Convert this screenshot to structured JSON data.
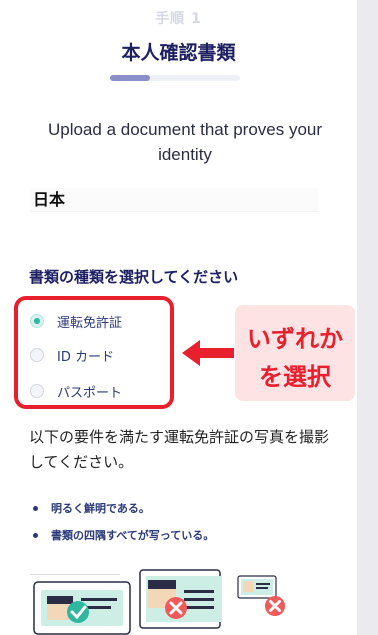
{
  "header": {
    "step": "手順 1",
    "title": "本人確認書類",
    "progress": 0.31
  },
  "subtitle": "Upload a document that proves your identity",
  "country": {
    "value": "日本"
  },
  "doc_type": {
    "label": "書類の種類を選択してください",
    "options": [
      {
        "label": "運転免許証",
        "selected": true
      },
      {
        "label": "ID カード",
        "selected": false
      },
      {
        "label": "パスポート",
        "selected": false
      }
    ]
  },
  "annotation": {
    "line1": "いずれか",
    "line2": "を選択",
    "color": "#e8202e"
  },
  "requirements": {
    "text": "以下の要件を満たす運転免許証の写真を撮影してください。",
    "bullets": [
      "明るく鮮明である。",
      "書類の四隅すべてが写っている。"
    ]
  },
  "examples": [
    {
      "icon": "check-icon",
      "status": "good"
    },
    {
      "icon": "cross-icon",
      "status": "bad"
    },
    {
      "icon": "cross-icon",
      "status": "bad"
    }
  ],
  "colors": {
    "accent": "#2fb7a1",
    "navy": "#1d1f63",
    "red": "#e8202e"
  }
}
